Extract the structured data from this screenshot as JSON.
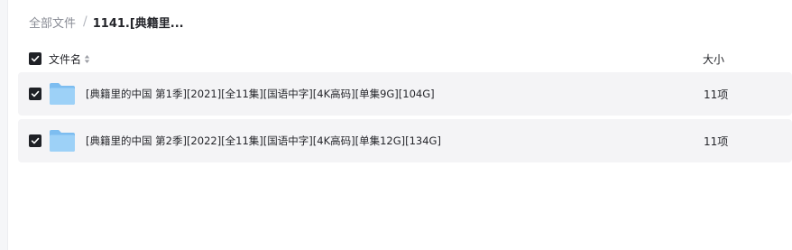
{
  "breadcrumb": {
    "root": "全部文件",
    "separator": "/",
    "current": "1141.[典籍里..."
  },
  "table": {
    "header": {
      "name_label": "文件名",
      "size_label": "大小",
      "select_all_checked": true
    },
    "rows": [
      {
        "name": "[典籍里的中国 第1季][2021][全11集][国语中字][4K高码][单集9G][104G]",
        "size": "11项",
        "checked": true,
        "icon": "folder-icon"
      },
      {
        "name": "[典籍里的中国 第2季][2022][全11集][国语中字][4K高码][单集12G][134G]",
        "size": "11项",
        "checked": true,
        "icon": "folder-icon"
      }
    ]
  },
  "colors": {
    "checkbox": "#1f2126",
    "row_background": "#f4f4f6",
    "folder": "#8cc8f5"
  }
}
